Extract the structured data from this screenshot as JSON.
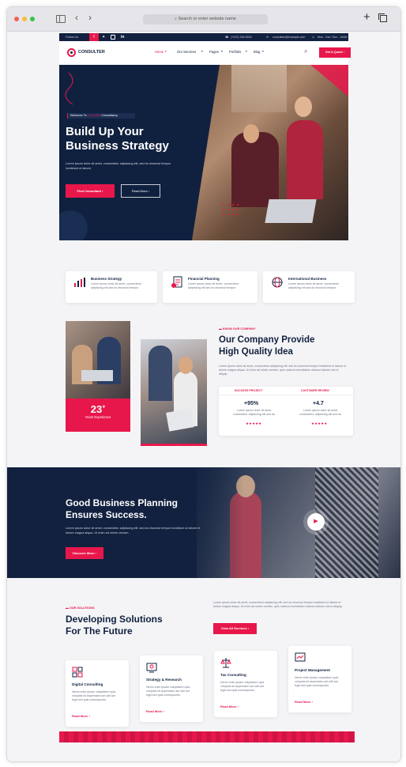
{
  "browser": {
    "url_placeholder": "Search or enter website name",
    "new_tab_icon": "plus-icon",
    "tabs_icon": "tabs-icon"
  },
  "topbar": {
    "follow_label": "Follow Us:",
    "social_icons": [
      "facebook-icon",
      "twitter-icon",
      "instagram-icon",
      "linkedin-icon"
    ],
    "phone": "(+012) 226-9524",
    "email": "consultant@example.com",
    "hours": "Mon - Sat / Sun - 10AM"
  },
  "nav": {
    "logo": "CONSULTER",
    "items": [
      "Home",
      "Our Services",
      "Pages",
      "Portfolio",
      "Blog"
    ],
    "cta": "Get A Quote"
  },
  "hero": {
    "tagline_prefix": "Welcome To",
    "tagline_brand": "Consulter",
    "tagline_suffix": "Consultancy",
    "title_line1": "Build Up Your",
    "title_line2": "Business Strategy",
    "text": "Lorem ipsum dolor sit amet, consectetur adipiscing elit, sed do eiusmod tempor incididunt ut labore.",
    "btn_primary": "Find Consultant",
    "btn_secondary": "Read More"
  },
  "services": [
    {
      "icon": "bar-chart-icon",
      "title": "Business Strategy",
      "text": "Lorem ipsum dolor sit amet, consectetur adipiscing elit sed do eiusmod tempor."
    },
    {
      "icon": "financial-doc-icon",
      "title": "Financial Planning",
      "text": "Lorem ipsum dolor sit amet, consectetur adipiscing elit sed do eiusmod tempor."
    },
    {
      "icon": "globe-icon",
      "title": "International Business",
      "text": "Lorem ipsum dolor sit amet, consectetur adipiscing elit sed do eiusmod tempor."
    }
  ],
  "about": {
    "kicker": "KNOW OUR COMPANY",
    "title_line1": "Our Company Provide",
    "title_line2": "High Quality Idea",
    "text": "Lorem ipsum dolor sit amet, consectetur adipiscing elit, sed do eiusmod tempor incididunt ut labore et dolore magna aliqua. Ut enim ad minim veniam, quis nostrud exercitation ullamco laboris nisi ut aliquip.",
    "experience_number": "23",
    "experience_plus": "+",
    "experience_label": "Years Experience",
    "stats": [
      {
        "label": "SUCCESS PROJECT",
        "value": "95%",
        "prefix": "+",
        "text": "Lorem ipsum dolor sit amet, consectetur adipiscing elit sed do.",
        "stars": "★★★★★"
      },
      {
        "label": "CUSTOMER REVIEW",
        "value": "4.7",
        "prefix": "+",
        "text": "Lorem ipsum dolor sit amet, consectetur adipiscing elit sed do.",
        "stars": "★★★★★"
      }
    ]
  },
  "video": {
    "title_line1": "Good Business Planning",
    "title_line2": "Ensures Success.",
    "text": "Lorem ipsum dolor sit amet, consectetur adipiscing elit, sed do eiusmod tempor incididunt ut labore et dolore magna aliqua. Ut enim ad minim veniam.",
    "btn": "Discover More",
    "play_icon": "play-icon"
  },
  "solutions": {
    "kicker": "OUR SOLUTIONS",
    "title_line1": "Developing Solutions",
    "title_line2": "For The Future",
    "text": "Lorem ipsum dolor sit amet, consectetur adipiscing elit, sed do eiusmod tempor incididunt ut labore et dolore magna aliqua. Ut enim ad minim veniam, quis nostrud exercitation ullamco laboris nisi ut aliquip.",
    "btn": "View All Services",
    "cards": [
      {
        "icon": "digital-icon",
        "title": "Digital Consulting",
        "text": "Nemo enim ipsam voluptatem quia voluptas sit aspernatur aut odit aut fugit sed quia consequuntu.",
        "link": "Read More"
      },
      {
        "icon": "strategy-icon",
        "title": "Strategy & Research",
        "text": "Nemo enim ipsam voluptatem quia voluptas sit aspernatur aut odit aut fugit sed quia consequuntu.",
        "link": "Read More"
      },
      {
        "icon": "scale-icon",
        "title": "Tax Consulting",
        "text": "Nemo enim ipsam voluptatem quia voluptas sit aspernatur aut odit aut fugit sed quia consequuntu.",
        "link": "Read More"
      },
      {
        "icon": "project-icon",
        "title": "Project Management",
        "text": "Nemo enim ipsam voluptatem quia voluptas sit aspernatur aut odit aut fugit sed quia consequuntu.",
        "link": "Read More"
      }
    ]
  },
  "colors": {
    "accent": "#e8174b",
    "navy": "#10213f",
    "bg": "#f4f4f6"
  }
}
